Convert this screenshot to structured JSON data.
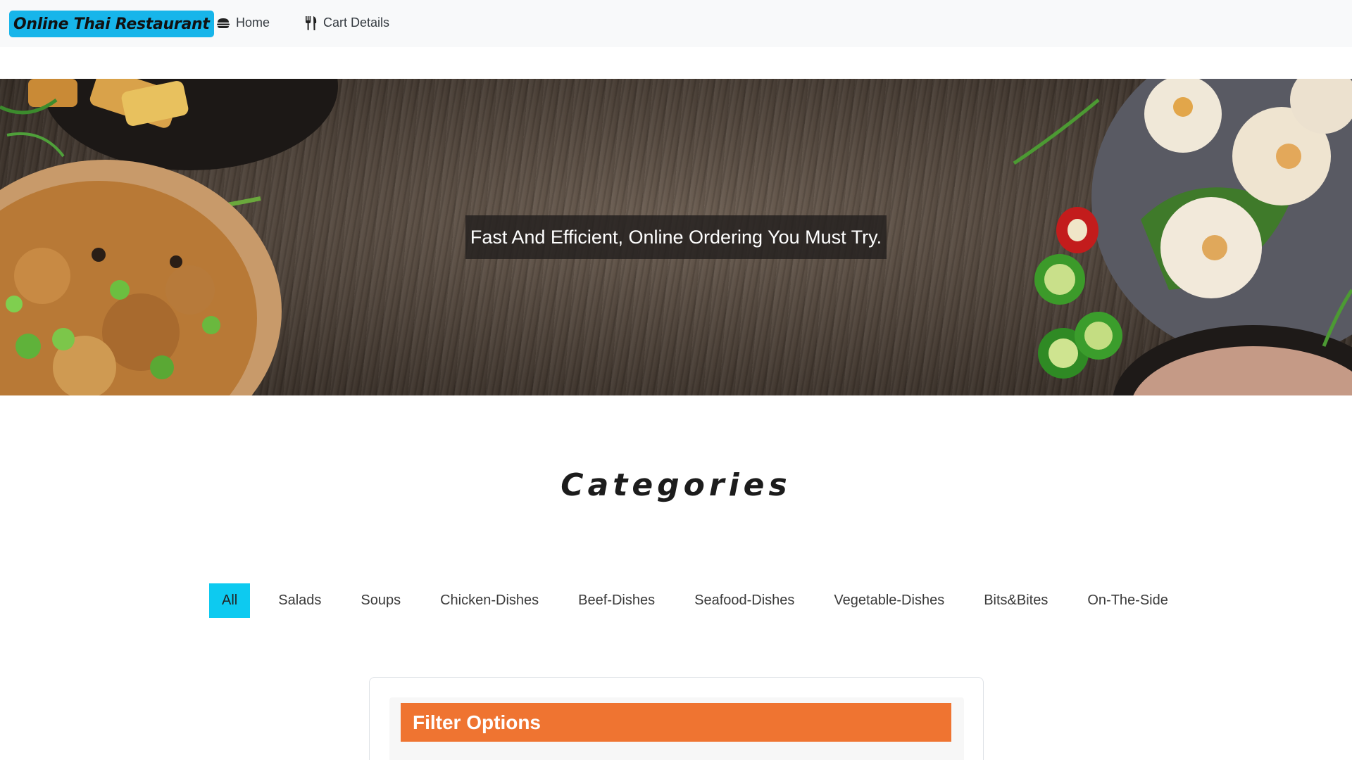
{
  "navbar": {
    "brand": "Online Thai Restaurant",
    "links": [
      {
        "label": "Home",
        "icon": "burger-icon"
      },
      {
        "label": "Cart Details",
        "icon": "utensils-icon"
      }
    ]
  },
  "hero": {
    "caption": "Fast And Efficient, Online Ordering You Must Try."
  },
  "categories": {
    "title": "Categories",
    "tabs": [
      "All",
      "Salads",
      "Soups",
      "Chicken-Dishes",
      "Beef-Dishes",
      "Seafood-Dishes",
      "Vegetable-Dishes",
      "Bits&Bites",
      "On-The-Side"
    ],
    "active": "All"
  },
  "filter": {
    "header": "Filter Options"
  },
  "colors": {
    "brand_bg": "#17b5ea",
    "active_tab": "#0dcaf0",
    "filter_header": "#ef7431"
  }
}
